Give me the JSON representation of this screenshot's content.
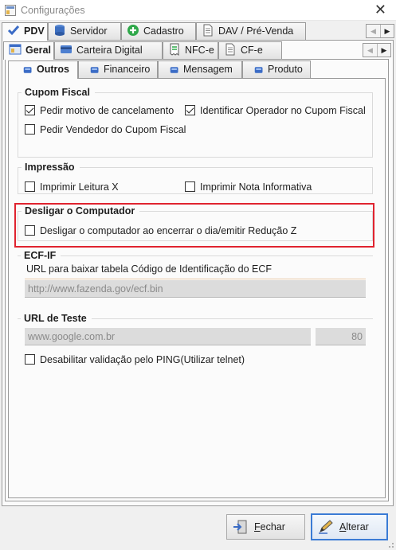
{
  "window": {
    "title": "Configurações",
    "close_glyph": "✕"
  },
  "main_tabs": [
    {
      "label": "PDV",
      "icon": "check-icon"
    },
    {
      "label": "Servidor",
      "icon": "database-icon"
    },
    {
      "label": "Cadastro",
      "icon": "plus-circle-icon"
    },
    {
      "label": "DAV / Pré-Venda",
      "icon": "document-icon"
    }
  ],
  "sub_tabs": [
    {
      "label": "Geral",
      "icon": "window-icon"
    },
    {
      "label": "Carteira Digital",
      "icon": "card-icon"
    },
    {
      "label": "NFC-e",
      "icon": "receipt-icon"
    },
    {
      "label": "CF-e",
      "icon": "document-icon"
    }
  ],
  "inner_tabs": [
    {
      "label": "Outros"
    },
    {
      "label": "Financeiro"
    },
    {
      "label": "Mensagem"
    },
    {
      "label": "Produto"
    }
  ],
  "scroll": {
    "left": "◀",
    "right": "▶"
  },
  "cupom_fiscal": {
    "title": "Cupom Fiscal",
    "pedir_motivo": {
      "label": "Pedir motivo de cancelamento",
      "checked": true
    },
    "identificar_operador": {
      "label": "Identificar Operador no Cupom Fiscal",
      "checked": true
    },
    "pedir_vendedor": {
      "label": "Pedir Vendedor do Cupom Fiscal",
      "checked": false
    }
  },
  "impressao": {
    "title": "Impressão",
    "leitura_x": {
      "label": "Imprimir Leitura X",
      "checked": false
    },
    "nota_informativa": {
      "label": "Imprimir Nota Informativa",
      "checked": false
    }
  },
  "desligar": {
    "title": "Desligar o Computador",
    "desligar_ao_encerrar": {
      "label": "Desligar o computador ao encerrar o dia/emitir Redução Z",
      "checked": false
    },
    "highlight_color": "#e0232f"
  },
  "ecf_if": {
    "title": "ECF-IF",
    "url_label": "URL para baixar tabela Código de Identificação do ECF",
    "url_value": "http://www.fazenda.gov/ecf.bin"
  },
  "url_teste": {
    "title": "URL de Teste",
    "url_value": "www.google.com.br",
    "port_value": "80",
    "desabilitar_ping": {
      "label": "Desabilitar validação pelo PING(Utilizar telnet)",
      "checked": false
    }
  },
  "buttons": {
    "fechar": {
      "label_u": "F",
      "label_rest": "echar",
      "icon": "exit-door-icon"
    },
    "alterar": {
      "label_u": "A",
      "label_rest": "lterar",
      "icon": "pen-icon"
    }
  }
}
